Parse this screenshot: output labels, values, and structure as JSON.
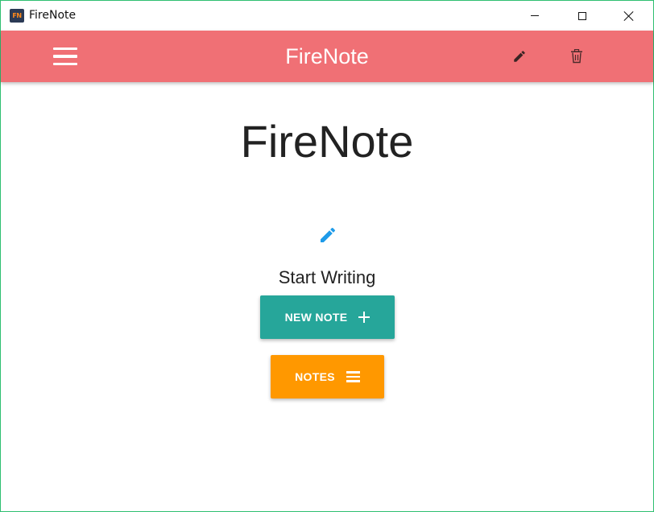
{
  "window": {
    "title": "FireNote",
    "icon_text": "FN",
    "controls": [
      "minimize-icon",
      "maximize-icon",
      "close-icon"
    ]
  },
  "appbar": {
    "title": "FireNote",
    "background": "#f07075",
    "icons": [
      "menu-icon",
      "pencil-icon",
      "trash-icon"
    ]
  },
  "main": {
    "heading": "FireNote",
    "prompt": "Start Writing",
    "prompt_icon": "pencil-icon",
    "prompt_icon_color": "#1e9be9",
    "new_note_label": "NEW NOTE",
    "new_note_color": "#26a69a",
    "notes_label": "NOTES",
    "notes_color": "#ff9800"
  }
}
